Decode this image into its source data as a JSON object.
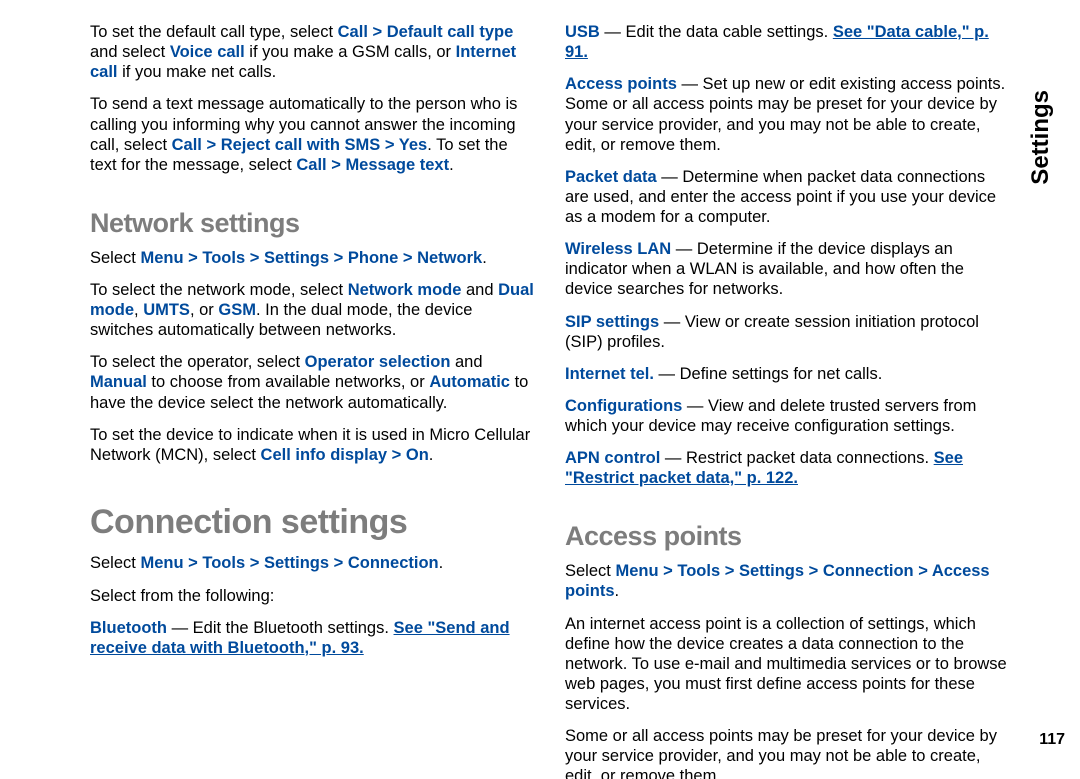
{
  "sideLabel": "Settings",
  "pageNumber": "117",
  "left": {
    "p1": {
      "t1": "To set the default call type, select ",
      "b1": "Call",
      "gt1": " > ",
      "b2": "Default call type",
      "t2": " and select ",
      "b3": "Voice call",
      "t3": " if you make a GSM calls, or ",
      "b4": "Internet call",
      "t4": " if you make net calls."
    },
    "p2": {
      "t1": "To send a text message automatically to the person who is calling you informing why you cannot answer the incoming call, select ",
      "b1": "Call",
      "gt1": " > ",
      "b2": "Reject call with SMS",
      "gt2": " > ",
      "b3": "Yes",
      "t2": ". To set the text for the message, select ",
      "b4": "Call",
      "gt3": " > ",
      "b5": "Message text",
      "t3": "."
    },
    "h2a": "Network settings",
    "p3": {
      "t1": "Select ",
      "b1": "Menu",
      "gt1": " > ",
      "b2": "Tools",
      "gt2": " > ",
      "b3": "Settings",
      "gt3": " > ",
      "b4": "Phone",
      "gt4": " > ",
      "b5": "Network",
      "t2": "."
    },
    "p4": {
      "t1": "To select the network mode, select ",
      "b1": "Network mode",
      "t2": " and ",
      "b2": "Dual mode",
      "t3": ", ",
      "b3": "UMTS",
      "t4": ", or ",
      "b4": "GSM",
      "t5": ". In the dual mode, the device switches automatically between networks."
    },
    "p5": {
      "t1": "To select the operator, select ",
      "b1": "Operator selection",
      "t2": " and ",
      "b2": "Manual",
      "t3": " to choose from available networks, or ",
      "b3": "Automatic",
      "t4": " to have the device select the network automatically."
    },
    "p6": {
      "t1": "To set the device to indicate when it is used in Micro Cellular Network (MCN), select ",
      "b1": "Cell info display",
      "gt1": " > ",
      "b2": "On",
      "t2": "."
    },
    "h1a": "Connection settings",
    "p7": {
      "t1": "Select ",
      "b1": "Menu",
      "gt1": " > ",
      "b2": "Tools",
      "gt2": " > ",
      "b3": "Settings",
      "gt3": " > ",
      "b4": "Connection",
      "t2": "."
    },
    "p8": "Select from the following:",
    "p9": {
      "b1": "Bluetooth",
      "t1": " — Edit the Bluetooth settings. ",
      "l1": "See \"Send and receive data with Bluetooth,\" p. 93."
    }
  },
  "right": {
    "d1": {
      "b": "USB",
      "t": " — Edit the data cable settings. ",
      "l": "See \"Data cable,\" p. 91."
    },
    "d2": {
      "b": "Access points",
      "t": " — Set up new or edit existing access points. Some or all access points may be preset for your device by your service provider, and you may not be able to create, edit, or remove them."
    },
    "d3": {
      "b": "Packet data",
      "t": " — Determine when packet data connections are used, and enter the access point if you use your device as a modem for a computer."
    },
    "d4": {
      "b": "Wireless LAN",
      "t": " — Determine if the device displays an indicator when a WLAN is available, and how often the device searches for networks."
    },
    "d5": {
      "b": "SIP settings",
      "t": " — View or create session initiation protocol (SIP) profiles."
    },
    "d6": {
      "b": "Internet tel.",
      "t": " — Define settings for net calls."
    },
    "d7": {
      "b": "Configurations",
      "t": " — View and delete trusted servers from which your device may receive configuration settings."
    },
    "d8": {
      "b": "APN control",
      "t": " — Restrict packet data connections. ",
      "l": "See \"Restrict packet data,\" p. 122."
    },
    "h2b": "Access points",
    "p10": {
      "t1": "Select ",
      "b1": "Menu",
      "gt1": " > ",
      "b2": "Tools",
      "gt2": " > ",
      "b3": "Settings",
      "gt3": " > ",
      "b4": "Connection",
      "gt4": " > ",
      "b5": "Access points",
      "t2": "."
    },
    "p11": "An internet access point is a collection of settings, which define how the device creates a data connection to the network. To use e-mail and multimedia services or to browse web pages, you must first define access points for these services.",
    "p12": "Some or all access points may be preset for your device by your service provider, and you may not be able to create, edit, or remove them."
  }
}
